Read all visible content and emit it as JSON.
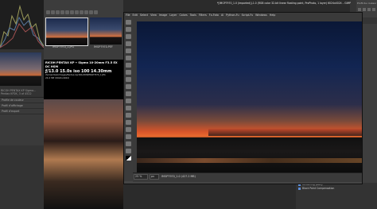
{
  "back_window": {
    "left_panel": {
      "info_lines": [
        "RICOH PENTAX KP Sigma...",
        "Pentax KP2K, 3 of 4522"
      ],
      "rows": [
        "Profile de couleur",
        "Profil d’affichage",
        "Profil d’export"
      ]
    },
    "filmstrip": {
      "thumb1_label": "IMGP7970_1.JPG",
      "thumb2_label": "IMGP7970.PEF"
    },
    "exif": {
      "camera": "RICOH PENTAX KP • Sigma 10-20mm F3.5 EX DC HSM",
      "settings": "ƒ/13.0  15.0s  iso 100  14.30mm",
      "path": "/home/rlilelo/Images/Pentax-kp/16K-2008/IMGP7970_1.JPG",
      "size": "24.2 MP (6024x4024)"
    },
    "right_panel": {
      "top_text": "Profil de couleur"
    },
    "bottom_right": {
      "rows": [
        "Rendering policy",
        "Black Point Compensation"
      ]
    }
  },
  "gimp": {
    "title": "*[IMGP7970_1.0 (imported)]-1.0 (RGB color 32-bit linear floating point, ProPhoto, 1 layer) 6024x4024 – GIMP",
    "menu": [
      "File",
      "Edit",
      "Select",
      "View",
      "Image",
      "Layer",
      "Colors",
      "Tools",
      "Filters",
      "Fx-Foto",
      "Ai",
      "Python-Fu",
      "Script-Fu",
      "Windows",
      "Help"
    ],
    "statusbar": {
      "unit": "px",
      "zoom": "25 %",
      "text": "IMGP7970_1.0 (427.2 MB)"
    },
    "tools": [
      "move-tool",
      "rect-select-tool",
      "lasso-tool",
      "fuzzy-select-tool",
      "crop-tool",
      "transform-tool",
      "warp-tool",
      "paths-tool",
      "text-tool",
      "bucket-fill-tool",
      "gradient-tool",
      "paintbrush-tool",
      "eraser-tool",
      "clone-tool",
      "smudge-tool",
      "dodge-burn-tool",
      "color-picker-tool",
      "measure-tool",
      "zoom-tool",
      "fg-bg-colors"
    ]
  },
  "colors": {
    "accent": "#5c8cd6",
    "sunset_orange": "#e96a2e",
    "sky_blue": "#122552"
  }
}
